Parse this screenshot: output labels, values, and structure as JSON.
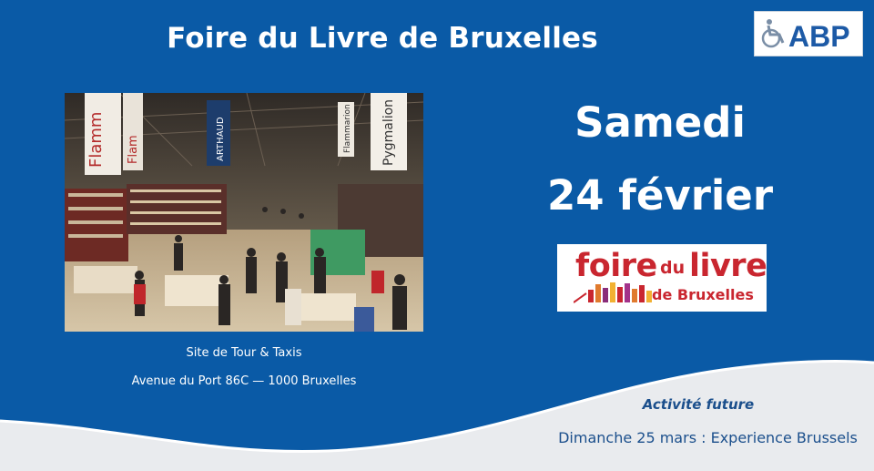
{
  "title": "Foire du Livre de Bruxelles",
  "logo_abp": {
    "text": "ABP",
    "icon": "wheelchair-icon"
  },
  "photo": {
    "banner_left": "Flamm",
    "banner_left2": "Flam",
    "banner_arthaud": "ARTHAUD",
    "banner_pygmalion": "Pygmalion",
    "banner_flammarion": "Flammarion"
  },
  "venue": {
    "line1": "Site de Tour & Taxis",
    "line2": "Avenue du Port 86C — 1000 Bruxelles"
  },
  "event": {
    "day": "Samedi",
    "date": "24 février"
  },
  "fair_logo": {
    "word1": "foire",
    "word2": "du",
    "word3": "livre",
    "word4": "de Bruxelles"
  },
  "future": {
    "label": "Activité future",
    "text": "Dimanche 25 mars : Experience Brussels"
  },
  "colors": {
    "background": "#0a5aa6",
    "wave": "#e9ebee",
    "accent_red": "#c9262f",
    "text_dark": "#1b4f8c"
  }
}
